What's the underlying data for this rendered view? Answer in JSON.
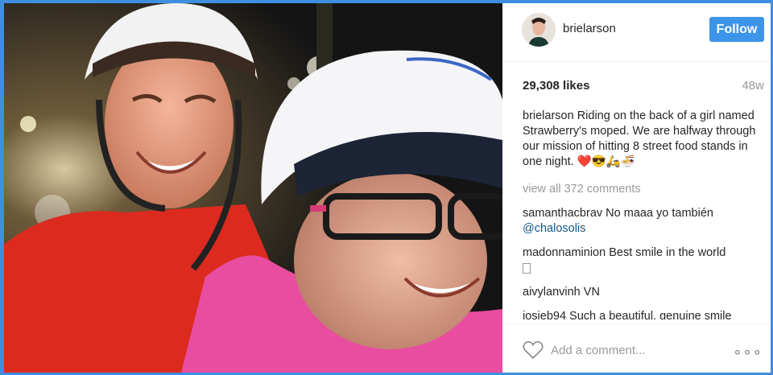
{
  "post": {
    "username": "brielarson",
    "follow_label": "Follow",
    "likes": "29,308 likes",
    "age": "48w",
    "caption_user": "brielarson",
    "caption_text": "Riding on the back of a girl named Strawberry's moped. We are halfway through our mission of hitting 8 street food stands in one night. ❤️😎🛵🍜",
    "view_all": "view all 372 comments",
    "add_comment_placeholder": "Add a comment...",
    "more_label": "∘∘∘"
  },
  "comments": [
    {
      "user": "samanthacbrav",
      "text": "No maaa yo también",
      "mention": "@chalosolis"
    },
    {
      "user": "madonnaminion",
      "text": "Best smile in the world"
    },
    {
      "user": "aivylanvinh",
      "text": "VN"
    },
    {
      "user": "iosieb94",
      "text": "Such a beautiful, genuine smile"
    }
  ],
  "colors": {
    "frame": "#3f8fe0",
    "follow_button": "#3d95ea",
    "mention": "#125688"
  },
  "icons": [
    "heart-icon",
    "more-options-icon"
  ]
}
